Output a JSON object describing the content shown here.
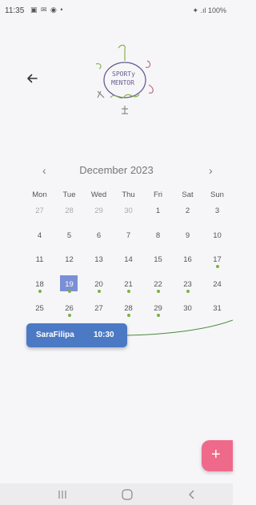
{
  "status_bar": {
    "time": "11:35",
    "icons": "▣ ✉ ◉ •",
    "right": "✦ .ıl 100%"
  },
  "logo": {
    "line1": "SPORTy",
    "line2": "MENTOR"
  },
  "calendar": {
    "month_label": "December 2023",
    "prev": "‹",
    "next": "›",
    "weekdays": [
      "Mon",
      "Tue",
      "Wed",
      "Thu",
      "Fri",
      "Sat",
      "Sun"
    ],
    "weeks": [
      [
        {
          "n": "27",
          "m": true
        },
        {
          "n": "28",
          "m": true
        },
        {
          "n": "29",
          "m": true
        },
        {
          "n": "30",
          "m": true
        },
        {
          "n": "1"
        },
        {
          "n": "2"
        },
        {
          "n": "3"
        }
      ],
      [
        {
          "n": "4"
        },
        {
          "n": "5"
        },
        {
          "n": "6"
        },
        {
          "n": "7"
        },
        {
          "n": "8"
        },
        {
          "n": "9"
        },
        {
          "n": "10"
        }
      ],
      [
        {
          "n": "11"
        },
        {
          "n": "12"
        },
        {
          "n": "13"
        },
        {
          "n": "14"
        },
        {
          "n": "15"
        },
        {
          "n": "16"
        },
        {
          "n": "17",
          "dot": true
        }
      ],
      [
        {
          "n": "18",
          "dot": true
        },
        {
          "n": "19",
          "dot": true,
          "sel": true
        },
        {
          "n": "20",
          "dot": true
        },
        {
          "n": "21",
          "dot": true
        },
        {
          "n": "22",
          "dot": true
        },
        {
          "n": "23",
          "dot": true
        },
        {
          "n": "24"
        }
      ],
      [
        {
          "n": "25"
        },
        {
          "n": "26",
          "dot": true
        },
        {
          "n": "27"
        },
        {
          "n": "28",
          "dot": true
        },
        {
          "n": "29",
          "dot": true
        },
        {
          "n": "30"
        },
        {
          "n": "31"
        }
      ]
    ]
  },
  "event": {
    "name": "SaraFilipa",
    "time": "10:30"
  },
  "fab": {
    "label": "+"
  },
  "colors": {
    "accent_event": "#4c79c4",
    "selected_day": "#7b8fd6",
    "dot": "#7bb23e",
    "fab": "#ef6a8a"
  }
}
